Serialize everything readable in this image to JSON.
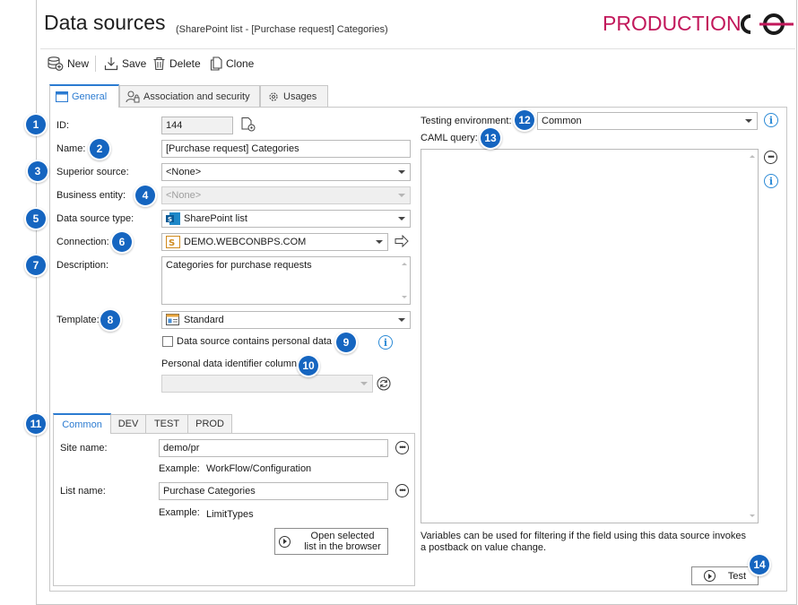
{
  "header": {
    "title": "Data sources",
    "subtitle": "(SharePoint list - [Purchase request] Categories)",
    "environment_label": "PRODUCTION"
  },
  "toolbar": {
    "new_label": "New",
    "save_label": "Save",
    "delete_label": "Delete",
    "clone_label": "Clone"
  },
  "tabs": [
    {
      "label": "General",
      "active": true
    },
    {
      "label": "Association and security",
      "active": false
    },
    {
      "label": "Usages",
      "active": false
    }
  ],
  "form": {
    "id_label": "ID:",
    "id_value": "144",
    "name_label": "Name:",
    "name_value": "[Purchase request] Categories",
    "superior_label": "Superior source:",
    "superior_value": "<None>",
    "entity_label": "Business entity:",
    "entity_value": "<None>",
    "type_label": "Data source type:",
    "type_value": "SharePoint list",
    "connection_label": "Connection:",
    "connection_value": "DEMO.WEBCONBPS.COM",
    "description_label": "Description:",
    "description_value": "Categories for purchase requests",
    "template_label": "Template:",
    "template_value": "Standard",
    "personal_data_label": "Data source contains personal data",
    "personal_id_label": "Personal data identifier column:",
    "personal_id_value": ""
  },
  "env_tabs": [
    {
      "label": "Common",
      "active": true
    },
    {
      "label": "DEV",
      "active": false
    },
    {
      "label": "TEST",
      "active": false
    },
    {
      "label": "PROD",
      "active": false
    }
  ],
  "env_form": {
    "site_label": "Site name:",
    "site_value": "demo/pr",
    "site_example_label": "Example:",
    "site_example_value": "WorkFlow/Configuration",
    "list_label": "List name:",
    "list_value": "Purchase Categories",
    "list_example_label": "Example:",
    "list_example_value": "LimitTypes",
    "open_button_line1": "Open selected",
    "open_button_line2": "list in the browser"
  },
  "right": {
    "testing_env_label": "Testing environment:",
    "testing_env_value": "Common",
    "caml_label": "CAML query:",
    "caml_value": "",
    "hint": "Variables can be used for filtering if the field using this data source invokes a postback on value change.",
    "test_button": "Test"
  },
  "badges": [
    "1",
    "2",
    "3",
    "4",
    "5",
    "6",
    "7",
    "8",
    "9",
    "10",
    "11",
    "12",
    "13",
    "14"
  ],
  "colors": {
    "accent": "#2b7bd1",
    "badge": "#1565c0",
    "production": "#c2185b"
  }
}
